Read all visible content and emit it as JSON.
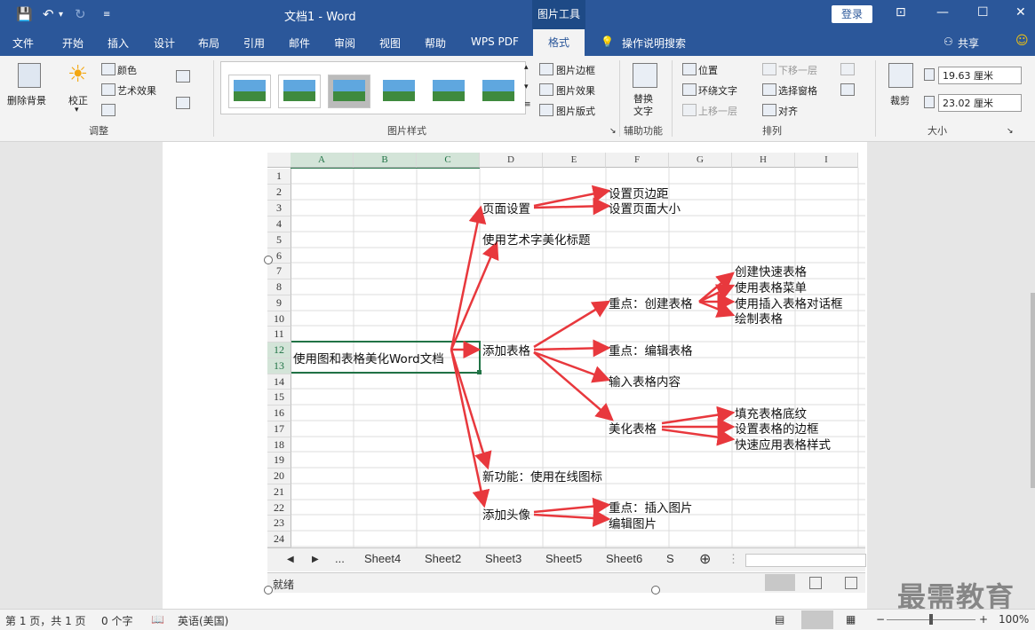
{
  "window": {
    "title": "文档1 - Word",
    "tool_context": "图片工具",
    "login": "登录",
    "share": "共享"
  },
  "menu": {
    "tabs": [
      "文件",
      "开始",
      "插入",
      "设计",
      "布局",
      "引用",
      "邮件",
      "审阅",
      "视图",
      "帮助",
      "WPS PDF",
      "格式"
    ],
    "active": "格式",
    "search": "操作说明搜索"
  },
  "ribbon": {
    "remove_bg": "删除背景",
    "corrections": "校正",
    "color": "颜色",
    "artistic": "艺术效果",
    "group_adjust": "调整",
    "group_styles": "图片样式",
    "border": "图片边框",
    "effects": "图片效果",
    "layout": "图片版式",
    "alt_text": "替换文字",
    "group_access": "辅助功能",
    "position": "位置",
    "wrap": "环绕文字",
    "forward": "上移一层",
    "backward": "下移一层",
    "selection_pane": "选择窗格",
    "align": "对齐",
    "group_arrange": "排列",
    "crop": "裁剪",
    "height": "19.63 厘米",
    "width": "23.02 厘米",
    "group_size": "大小"
  },
  "sheet": {
    "columns": [
      "A",
      "B",
      "C",
      "D",
      "E",
      "F",
      "G",
      "H",
      "I"
    ],
    "rows": [
      "1",
      "2",
      "3",
      "4",
      "5",
      "6",
      "7",
      "8",
      "9",
      "10",
      "11",
      "12",
      "13",
      "14",
      "15",
      "16",
      "17",
      "18",
      "19",
      "20",
      "21",
      "22",
      "23",
      "24"
    ],
    "root": "使用图和表格美化Word文档",
    "d3": "页面设置",
    "d5": "使用艺术字美化标题",
    "d12": "添加表格",
    "d20": "新功能：使用在线图标",
    "d22": "添加头像",
    "f2": "设置页边距",
    "f3": "设置页面大小",
    "f9": "重点：创建表格",
    "f12": "重点：编辑表格",
    "f14": "输入表格内容",
    "f17": "美化表格",
    "f22": "重点：插入图片",
    "f23": "编辑图片",
    "h7": "创建快速表格",
    "h8": "使用表格菜单",
    "h9": "使用插入表格对话框",
    "h10": "绘制表格",
    "h16": "填充表格底纹",
    "h17": "设置表格的边框",
    "h18": "快速应用表格样式",
    "arrow_color": "#e8383d",
    "tabs": [
      "Sheet4",
      "Sheet2",
      "Sheet3",
      "Sheet5",
      "Sheet6",
      "S"
    ],
    "ellipsis": "...",
    "ready": "就绪"
  },
  "status": {
    "page": "第 1 页，共 1 页",
    "words": "0 个字",
    "lang": "英语(美国)",
    "zoom": "100%"
  },
  "watermark": "最需教育"
}
